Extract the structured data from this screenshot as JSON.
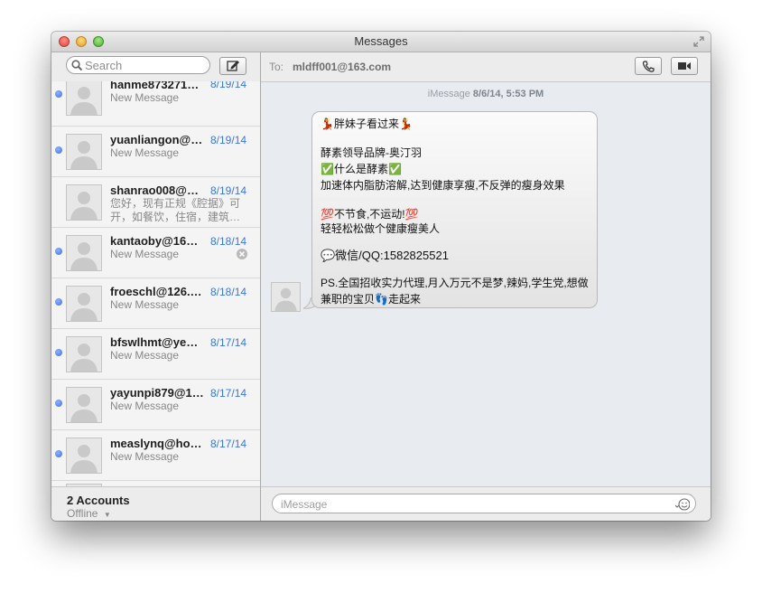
{
  "window": {
    "title": "Messages"
  },
  "search": {
    "placeholder": "Search"
  },
  "conversations": [
    {
      "name": "hanme873271…",
      "date": "8/19/14",
      "preview": "New Message",
      "unread": true
    },
    {
      "name": "yuanliangon@…",
      "date": "8/19/14",
      "preview": "New Message",
      "unread": true
    },
    {
      "name": "shanrao008@…",
      "date": "8/19/14",
      "preview_line1": "您好，现有正规《腔据》可",
      "preview_line2": "开，如餐饮，住宿，建筑…",
      "unread": false
    },
    {
      "name": "kantaoby@16…",
      "date": "8/18/14",
      "preview": "New Message",
      "unread": true
    },
    {
      "name": "froeschl@126.…",
      "date": "8/18/14",
      "preview": "New Message",
      "unread": true
    },
    {
      "name": "bfswlhmt@ye…",
      "date": "8/17/14",
      "preview": "New Message",
      "unread": true
    },
    {
      "name": "yayunpi879@1…",
      "date": "8/17/14",
      "preview": "New Message",
      "unread": true
    },
    {
      "name": "measlynq@ho…",
      "date": "8/17/14",
      "preview": "New Message",
      "unread": true
    }
  ],
  "accounts": {
    "label": "2 Accounts",
    "status": "Offline"
  },
  "header": {
    "to_label": "To:",
    "recipient": "mldff001@163.com"
  },
  "chat": {
    "service": "iMessage",
    "timestamp": "8/6/14, 5:53 PM",
    "message_lines": [
      "💃胖妹子看过来💃",
      "酵素领导品牌-奥汀羽",
      "✅什么是酵素✅",
      "加速体内脂肪溶解,达到健康享瘦,不反弹的瘦身效果",
      "💯不节食,不运动!💯",
      "轻轻松松做个健康瘦美人",
      "💬微信/QQ:1582825521",
      "PS.全国招收实力代理,月入万元不是梦,辣妈,学生党,想做",
      "兼职的宝贝👣走起来"
    ]
  },
  "composer": {
    "placeholder": "iMessage"
  },
  "icons": {
    "search": "magnifier-icon",
    "compose": "compose-icon",
    "phone": "phone-icon",
    "video": "video-camera-icon",
    "emoji": "smiley-icon",
    "avatar": "person-silhouette-icon",
    "fullscreen": "fullscreen-arrows-icon"
  },
  "colors": {
    "unread_dot": "#3c6ee6",
    "date": "#3b78d8"
  }
}
